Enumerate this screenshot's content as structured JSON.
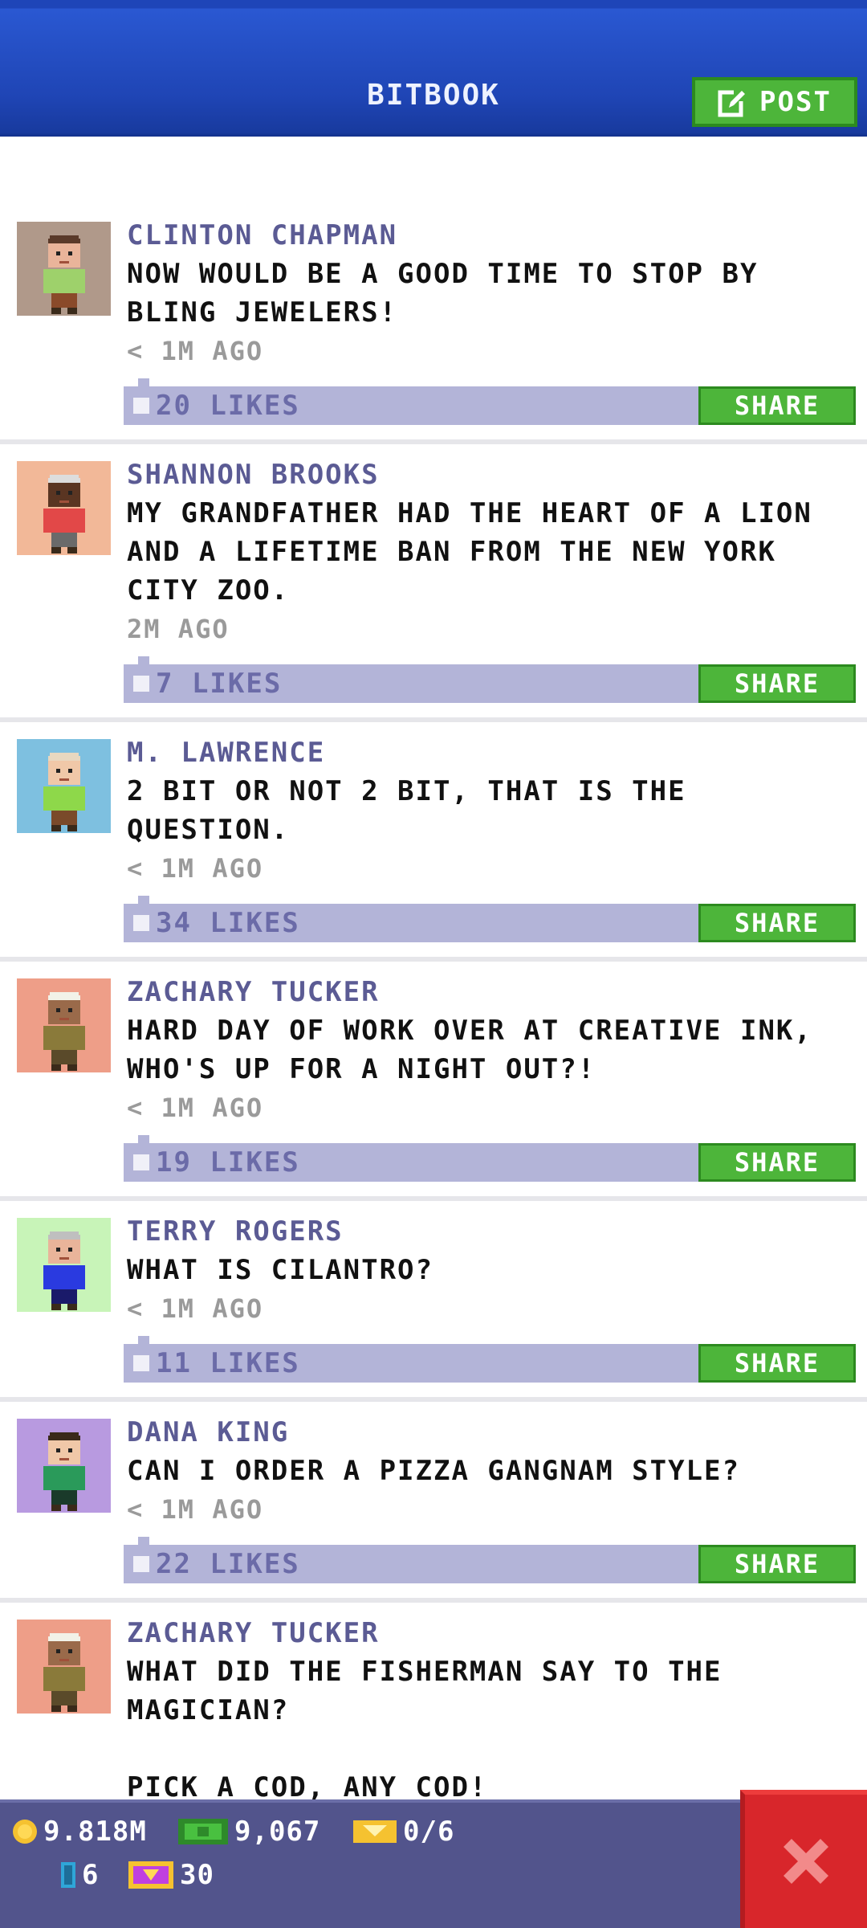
{
  "header": {
    "title": "BITBOOK",
    "post_label": "POST"
  },
  "posts": [
    {
      "name": "CLINTON CHAPMAN",
      "message": "NOW WOULD BE A GOOD TIME TO STOP BY BLING JEWELERS!",
      "time": "< 1M AGO",
      "likes": "20 LIKES",
      "share": "SHARE",
      "avatar": {
        "bg": "#b0998a",
        "skin": "#e9b49a",
        "hair": "#5a3a2a",
        "shirt": "#9ed16b",
        "pants": "#8a4a2a"
      }
    },
    {
      "name": "SHANNON BROOKS",
      "message": "MY GRANDFATHER HAD THE HEART OF A LION AND A LIFETIME BAN FROM THE NEW YORK CITY ZOO.",
      "time": "2M AGO",
      "likes": "7 LIKES",
      "share": "SHARE",
      "avatar": {
        "bg": "#f2b898",
        "skin": "#5a3522",
        "hair": "#dddddd",
        "shirt": "#e24848",
        "pants": "#6a6a6a"
      }
    },
    {
      "name": "M. LAWRENCE",
      "message": "2 BIT OR NOT 2 BIT, THAT IS THE QUESTION.",
      "time": "< 1M AGO",
      "likes": "34 LIKES",
      "share": "SHARE",
      "avatar": {
        "bg": "#7ec0e0",
        "skin": "#f0c8a8",
        "hair": "#e8d8c0",
        "shirt": "#8ed84a",
        "pants": "#7a4a2a"
      }
    },
    {
      "name": "ZACHARY TUCKER",
      "message": "HARD DAY OF WORK OVER AT CREATIVE INK, WHO'S UP FOR A NIGHT OUT?!",
      "time": "< 1M AGO",
      "likes": "19 LIKES",
      "share": "SHARE",
      "avatar": {
        "bg": "#ee9e88",
        "skin": "#9a6a4a",
        "hair": "#f2f2e8",
        "shirt": "#8a7a3a",
        "pants": "#5a4a2a"
      }
    },
    {
      "name": "TERRY ROGERS",
      "message": "WHAT IS CILANTRO?",
      "time": "< 1M AGO",
      "likes": "11 LIKES",
      "share": "SHARE",
      "avatar": {
        "bg": "#c8f4b8",
        "skin": "#e9b49a",
        "hair": "#bfbfbf",
        "shirt": "#2a3ae0",
        "pants": "#1a1a6a"
      }
    },
    {
      "name": "DANA KING",
      "message": "CAN I ORDER A PIZZA GANGNAM STYLE?",
      "time": "< 1M AGO",
      "likes": "22 LIKES",
      "share": "SHARE",
      "avatar": {
        "bg": "#b89ae0",
        "skin": "#f0c8a8",
        "hair": "#3a2a1a",
        "shirt": "#2a9a5a",
        "pants": "#1a3a2a"
      }
    },
    {
      "name": "ZACHARY TUCKER",
      "message": "WHAT DID THE FISHERMAN SAY TO THE MAGICIAN?\n\nPICK A COD, ANY COD!",
      "time": "< 1M AGO",
      "likes": "",
      "share": "",
      "avatar": {
        "bg": "#ee9e88",
        "skin": "#9a6a4a",
        "hair": "#f2f2e8",
        "shirt": "#8a7a3a",
        "pants": "#5a4a2a"
      }
    }
  ],
  "footer": {
    "coins": "9.818M",
    "bux": "9,067",
    "tickets": "0/6",
    "elevators": "6",
    "vip": "30"
  },
  "colors": {
    "header": "#1f45b5",
    "name": "#5b5b94",
    "likes_bar": "#b3b4d8",
    "share": "#4db53a",
    "footer": "#52548c",
    "close": "#d8262b"
  }
}
